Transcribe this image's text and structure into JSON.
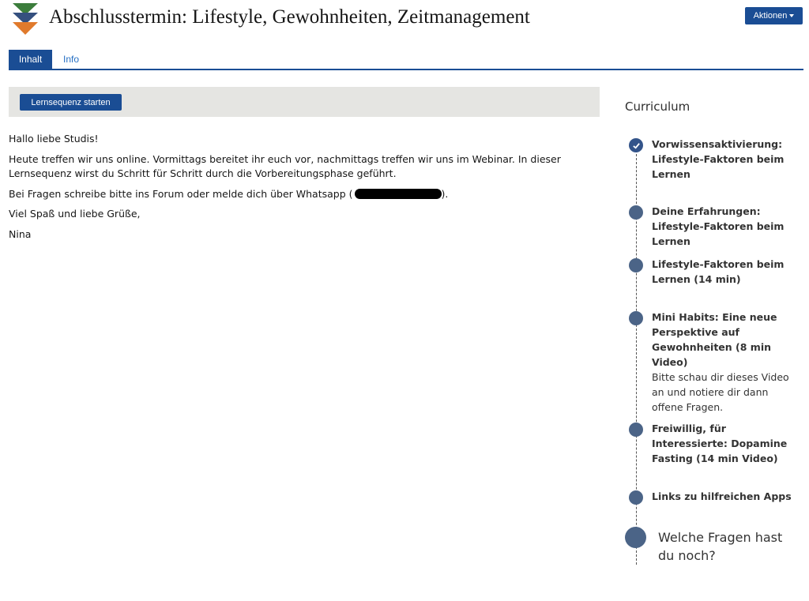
{
  "header": {
    "title": "Abschlusstermin: Lifestyle, Gewohnheiten, Zeitmanagement",
    "actions_label": "Aktionen",
    "logo_colors": [
      "#3c7d3c",
      "#35507f",
      "#e07a2c"
    ]
  },
  "tabs": [
    {
      "label": "Inhalt",
      "active": true
    },
    {
      "label": "Info",
      "active": false
    }
  ],
  "start_button_label": "Lernsequenz starten",
  "content": {
    "greeting": "Hallo liebe Studis!",
    "paragraph1": "Heute treffen wir uns online. Vormittags bereitet ihr euch vor, nachmittags treffen wir uns im Webinar. In dieser Lernsequenz wirst du Schritt für Schritt durch die Vorbereitungsphase geführt.",
    "questions": "Bei Fragen schreibe bitte ins Forum oder melde dich über Whatsapp (",
    "questions_end": ").",
    "farewell": "Viel Spaß und liebe Grüße,",
    "signature": "Nina"
  },
  "curriculum": {
    "title": "Curriculum",
    "items": [
      {
        "label": "Vorwissensaktivierung: Lifestyle-Faktoren beim Lernen",
        "completed": true,
        "icon": "check-icon"
      },
      {
        "label": "Deine Erfahrungen: Lifestyle-Faktoren beim Lernen",
        "completed": false
      },
      {
        "label": "Lifestyle-Faktoren beim Lernen (14 min)",
        "completed": false
      },
      {
        "label": "Mini Habits: Eine neue Perspektive auf Gewohnheiten (8 min Video)",
        "description": "Bitte schau dir dieses Video an und notiere dir dann offene Fragen.",
        "completed": false
      },
      {
        "label": "Freiwillig, für Interessierte: Dopamine Fasting (14 min Video)",
        "completed": false
      },
      {
        "label": "Links zu hilfreichen Apps",
        "completed": false
      }
    ],
    "final_item": "Welche Fragen hast du noch?"
  },
  "colors": {
    "primary": "#1a4d94",
    "link": "#2770c4",
    "timeline_dot": "#4b6487",
    "bar_background": "#e5e5e2"
  }
}
